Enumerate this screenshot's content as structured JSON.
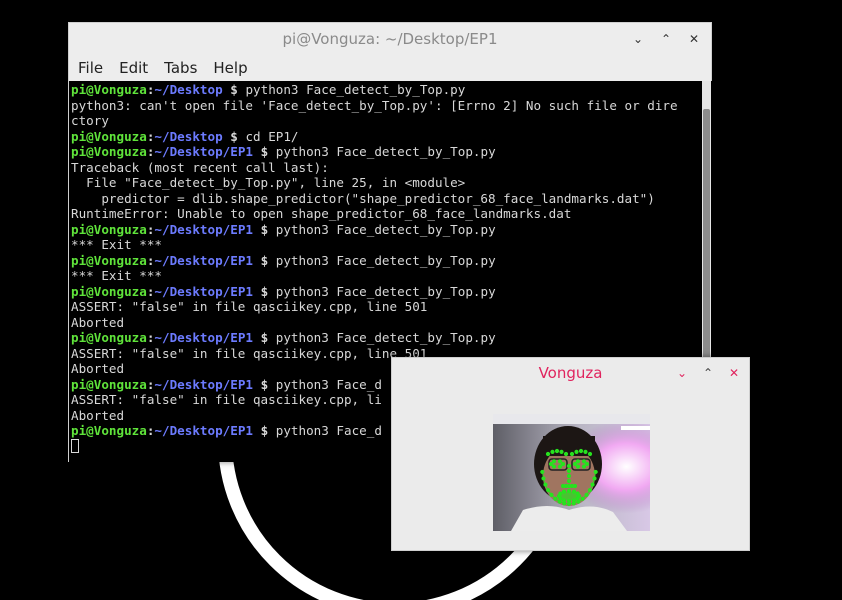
{
  "terminal": {
    "title": "pi@Vonguza: ~/Desktop/EP1",
    "controls": {
      "minimize": "⌄",
      "maximize": "⌃",
      "close": "✕"
    },
    "menu": [
      "File",
      "Edit",
      "Tabs",
      "Help"
    ],
    "lines": [
      {
        "user": "pi@Vonguza",
        "path": "~/Desktop",
        "cmd": " $ python3 Face_detect_by_Top.py"
      },
      {
        "text": "python3: can't open file 'Face_detect_by_Top.py': [Errno 2] No such file or dire"
      },
      {
        "text": "ctory"
      },
      {
        "user": "pi@Vonguza",
        "path": "~/Desktop",
        "cmd": " $ cd EP1/"
      },
      {
        "user": "pi@Vonguza",
        "path": "~/Desktop/EP1",
        "cmd": " $ python3 Face_detect_by_Top.py"
      },
      {
        "text": "Traceback (most recent call last):"
      },
      {
        "text": "  File \"Face_detect_by_Top.py\", line 25, in <module>"
      },
      {
        "text": "    predictor = dlib.shape_predictor(\"shape_predictor_68_face_landmarks.dat\")"
      },
      {
        "text": "RuntimeError: Unable to open shape_predictor_68_face_landmarks.dat"
      },
      {
        "user": "pi@Vonguza",
        "path": "~/Desktop/EP1",
        "cmd": " $ python3 Face_detect_by_Top.py"
      },
      {
        "text": "*** Exit ***"
      },
      {
        "user": "pi@Vonguza",
        "path": "~/Desktop/EP1",
        "cmd": " $ python3 Face_detect_by_Top.py"
      },
      {
        "text": "*** Exit ***"
      },
      {
        "user": "pi@Vonguza",
        "path": "~/Desktop/EP1",
        "cmd": " $ python3 Face_detect_by_Top.py"
      },
      {
        "text": "ASSERT: \"false\" in file qasciikey.cpp, line 501"
      },
      {
        "text": "Aborted"
      },
      {
        "user": "pi@Vonguza",
        "path": "~/Desktop/EP1",
        "cmd": " $ python3 Face_detect_by_Top.py"
      },
      {
        "text": "ASSERT: \"false\" in file qasciikey.cpp, line 501"
      },
      {
        "text": "Aborted"
      },
      {
        "user": "pi@Vonguza",
        "path": "~/Desktop/EP1",
        "cmd": " $ python3 Face_d"
      },
      {
        "text": "ASSERT: \"false\" in file qasciikey.cpp, li"
      },
      {
        "text": "Aborted"
      },
      {
        "user": "pi@Vonguza",
        "path": "~/Desktop/EP1",
        "cmd": " $ python3 Face_d"
      },
      {
        "cursor": true
      }
    ]
  },
  "viewer": {
    "title": "Vonguza",
    "controls": {
      "minimize": "⌄",
      "maximize": "⌃",
      "close": "✕"
    }
  },
  "colors": {
    "prompt_user": "#5fe33a",
    "prompt_path": "#6c7bff",
    "viewer_title": "#e0245e",
    "landmarks": "#27e31f"
  }
}
